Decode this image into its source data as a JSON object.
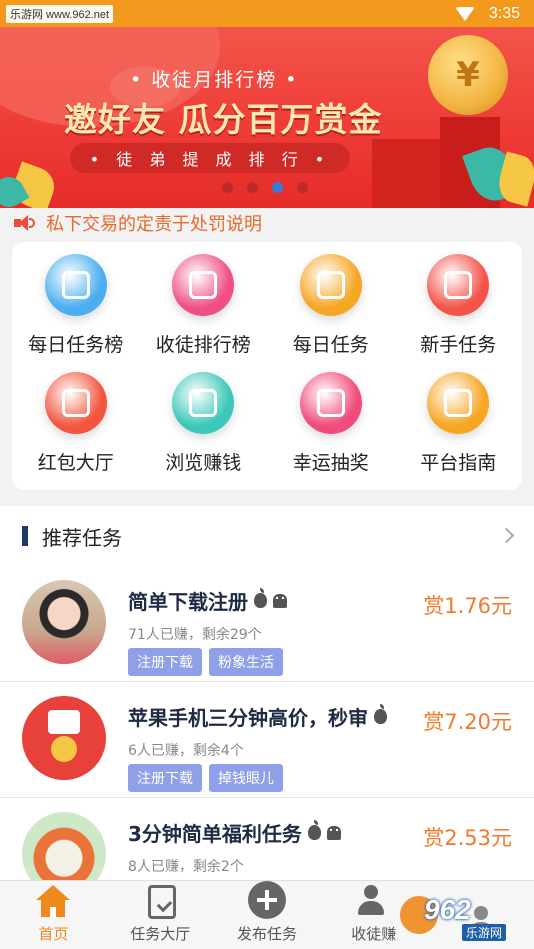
{
  "status_bar": {
    "watermark": "乐游网 www.962.net",
    "time": "3:35"
  },
  "banner": {
    "subtitle": "• 收徒月排行榜 •",
    "title": "邀好友 瓜分百万赏金",
    "pill": "• 徒 弟 提 成 排 行 •",
    "coin_symbol": "¥",
    "dot_count": 4,
    "active_dot": 3
  },
  "notice": {
    "text": "私下交易的定责于处罚说明"
  },
  "grid": {
    "items": [
      {
        "label": "每日任务榜",
        "icon": "task-list-icon",
        "color": "#4aaef0"
      },
      {
        "label": "收徒排行榜",
        "icon": "apprentice-ranking-icon",
        "color": "#ef4f86"
      },
      {
        "label": "每日任务",
        "icon": "daily-task-icon",
        "color": "#f5a623"
      },
      {
        "label": "新手任务",
        "icon": "gift-icon",
        "color": "#f4534a"
      },
      {
        "label": "红包大厅",
        "icon": "red-envelope-icon",
        "color": "#f3553f"
      },
      {
        "label": "浏览赚钱",
        "icon": "footprint-icon",
        "color": "#3cc7b8"
      },
      {
        "label": "幸运抽奖",
        "icon": "lottery-icon",
        "color": "#f04b7a"
      },
      {
        "label": "平台指南",
        "icon": "compass-icon",
        "color": "#f6a623"
      }
    ]
  },
  "recommended": {
    "title": "推荐任务",
    "tasks": [
      {
        "title": "简单下载注册",
        "meta": "71人已赚，剩余29个",
        "tags": [
          "注册下载",
          "粉象生活"
        ],
        "reward": "赏1.76元",
        "platforms": [
          "apple",
          "android"
        ]
      },
      {
        "title": "苹果手机三分钟高价，秒审",
        "meta": "6人已赚，剩余4个",
        "tags": [
          "注册下载",
          "掉钱眼儿"
        ],
        "reward": "赏7.20元",
        "platforms": [
          "apple"
        ]
      },
      {
        "title": "3分钟简单福利任务",
        "meta": "8人已赚，剩余2个",
        "tags": [],
        "reward": "赏2.53元",
        "platforms": [
          "apple",
          "android"
        ]
      }
    ]
  },
  "bottom_nav": {
    "items": [
      {
        "label": "首页",
        "icon": "home-icon",
        "active": true
      },
      {
        "label": "任务大厅",
        "icon": "clipboard-icon",
        "active": false
      },
      {
        "label": "发布任务",
        "icon": "plus-circle-icon",
        "active": false
      },
      {
        "label": "收徒赚",
        "icon": "users-icon",
        "active": false
      },
      {
        "label": "",
        "icon": "user-icon",
        "active": false
      }
    ]
  },
  "site_watermark": {
    "text": "962",
    "sub": "乐游网"
  },
  "colors": {
    "accent": "#f08a1c",
    "banner_red": "#ee3a35",
    "reward_orange": "#f2792a",
    "tag_blue": "#8fa0e8",
    "notice_orange": "#e8692c"
  }
}
